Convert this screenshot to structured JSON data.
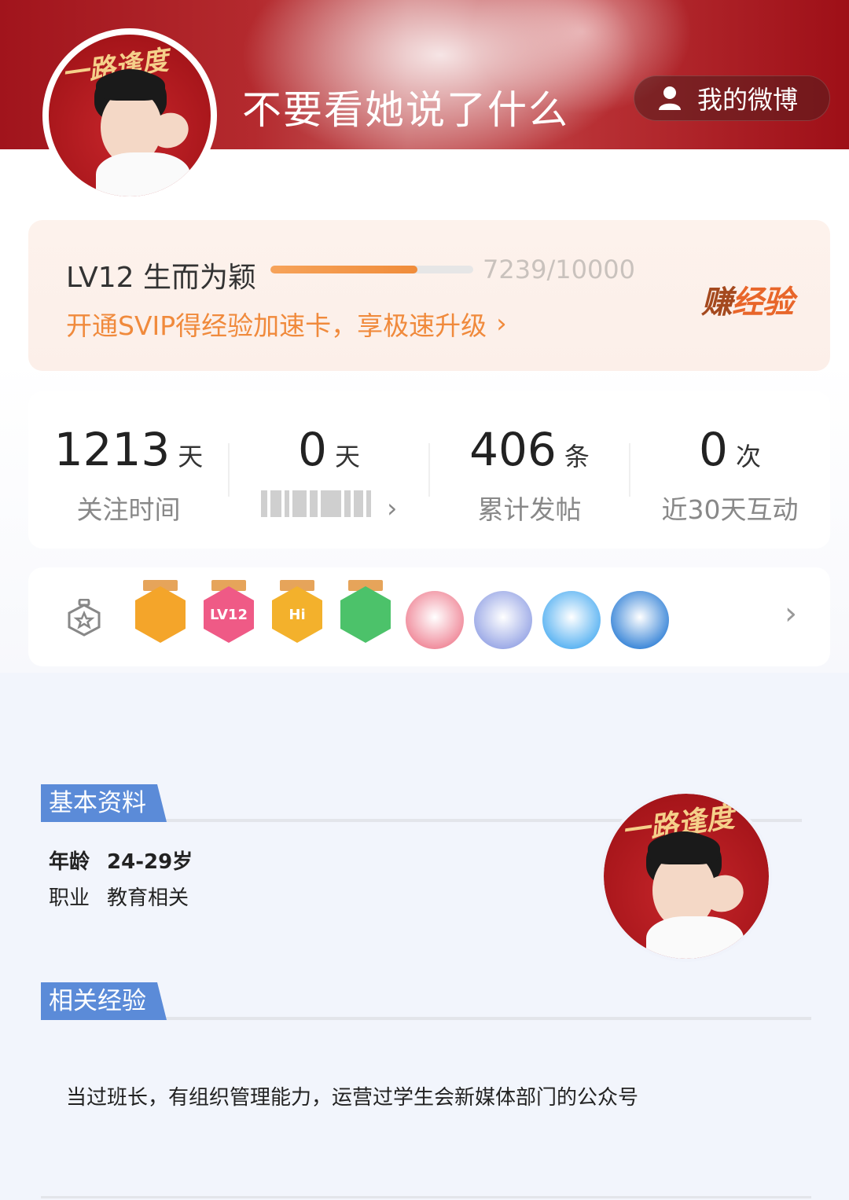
{
  "header": {
    "title": "不要看她说了什么",
    "weibo_button": "我的微博",
    "avatar_caption": "一路逢度"
  },
  "level": {
    "name": "LV12 生而为颖",
    "progress_text": "7239/10000",
    "progress_fraction": 0.7239,
    "svip_link": "开通SVIP得经验加速卡，享极速升级",
    "earn_button_a": "赚",
    "earn_button_b": "经验"
  },
  "stats": [
    {
      "value": "1213",
      "unit": "天",
      "label": "关注时间"
    },
    {
      "value": "0",
      "unit": "天",
      "label": ""
    },
    {
      "value": "406",
      "unit": "条",
      "label": "累计发帖"
    },
    {
      "value": "0",
      "unit": "次",
      "label": "近30天互动"
    }
  ],
  "badges": [
    {
      "icon": "crown-badge-icon",
      "color": "#f4a52a",
      "text": ""
    },
    {
      "icon": "lv12-badge-icon",
      "color": "#ef5a86",
      "text": "LV12"
    },
    {
      "icon": "hi-badge-icon",
      "color": "#f3b12c",
      "text": "Hi"
    },
    {
      "icon": "hand-badge-icon",
      "color": "#4cc26a",
      "text": ""
    },
    {
      "icon": "cake-badge-icon",
      "color": "#f08a9a",
      "text": ""
    },
    {
      "icon": "boy-badge-icon",
      "color": "#9aa8e6",
      "text": ""
    },
    {
      "icon": "mascot-badge-icon",
      "color": "#5ab3f2",
      "text": ""
    },
    {
      "icon": "sunflower-badge-icon",
      "color": "#3a86d8",
      "text": ""
    }
  ],
  "basic_info": {
    "title": "基本资料",
    "age_label": "年龄",
    "age_value": "24-29岁",
    "job_label": "职业",
    "job_value": "教育相关"
  },
  "experience": {
    "title": "相关经验",
    "text": "当过班长，有组织管理能力，运营过学生会新媒体部门的公众号"
  },
  "colors": {
    "header_red": "#a1141c",
    "accent_orange": "#f08a3c",
    "section_blue": "#5b8bd8"
  }
}
